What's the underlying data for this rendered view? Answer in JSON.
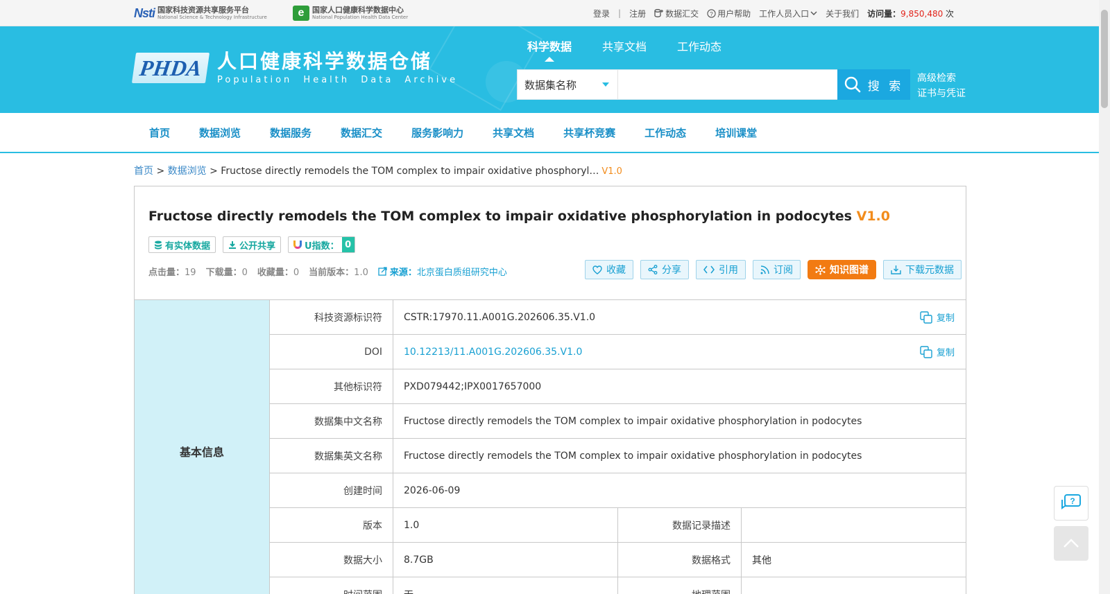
{
  "logos": {
    "nsti_mark": "Nsti",
    "nsti_cn": "国家科技资源共享服务平台",
    "nsti_en": "National Science & Technology Infrastructure",
    "nphdc_mark": "e",
    "nphdc_cn": "国家人口健康科学数据中心",
    "nphdc_en": "National Population Health Data Center",
    "phda_mark": "PHDA",
    "phda_cn": "人口健康科学数据仓储",
    "phda_en": "Population  Health  Data  Archive"
  },
  "toplinks": {
    "login": "登录",
    "separator": "|",
    "register": "注册",
    "data_submit": "数据汇交",
    "help": "用户帮助",
    "staff": "工作人员入口",
    "about": "关于我们",
    "visits_label": "访问量：",
    "visits_value": "9,850,480",
    "visits_unit": " 次"
  },
  "banner_nav": {
    "items": [
      {
        "label": "科学数据",
        "active": true
      },
      {
        "label": "共享文档",
        "active": false
      },
      {
        "label": "工作动态",
        "active": false
      }
    ]
  },
  "search": {
    "scope": "数据集名称",
    "query": "",
    "button": "搜 索",
    "advanced": "高级检索",
    "certificate": "证书与凭证"
  },
  "main_nav": [
    "首页",
    "数据浏览",
    "数据服务",
    "数据汇交",
    "服务影响力",
    "共享文档",
    "共享杯竞赛",
    "工作动态",
    "培训课堂"
  ],
  "breadcrumb": {
    "home": "首页",
    "sep1": " > ",
    "browse": "数据浏览",
    "sep2": " > ",
    "current": "Fructose directly remodels the TOM complex to impair oxidative phosphoryl…",
    "version": "V1.0"
  },
  "dataset": {
    "title": "Fructose directly remodels the TOM complex to impair oxidative phosphorylation in podocytes",
    "version": "V1.0",
    "badges": {
      "entity": "有实体数据",
      "open": "公开共享",
      "uindex_label": "U指数：",
      "uindex_value": "0"
    },
    "stats": {
      "clicks_label": "点击量：",
      "clicks": "19",
      "downloads_label": "下载量：",
      "downloads": "0",
      "favorites_label": "收藏量：",
      "favorites": "0",
      "current_version_label": "当前版本：",
      "current_version": "1.0",
      "source_label": "来源：",
      "source": "北京蛋白质组研究中心"
    },
    "actions": {
      "favorite": "收藏",
      "share": "分享",
      "cite": "引用",
      "subscribe": "订阅",
      "knowledge_graph": "知识图谱",
      "download_meta": "下载元数据"
    }
  },
  "basic_info": {
    "section_title": "基本信息",
    "copy_label": "复制",
    "cstr_label": "科技资源标识符",
    "cstr": "CSTR:17970.11.A001G.202606.35.V1.0",
    "doi_label": "DOI",
    "doi": "10.12213/11.A001G.202606.35.V1.0",
    "other_id_label": "其他标识符",
    "other_id": "PXD079442;IPX0017657000",
    "cn_name_label": "数据集中文名称",
    "cn_name": "Fructose directly remodels the TOM complex to impair oxidative phosphorylation in podocytes",
    "en_name_label": "数据集英文名称",
    "en_name": "Fructose directly remodels the TOM complex to impair oxidative phosphorylation in podocytes",
    "created_label": "创建时间",
    "created": "2026-06-09",
    "version_label": "版本",
    "version": "1.0",
    "record_desc_label": "数据记录描述",
    "record_desc": "",
    "size_label": "数据大小",
    "size": "8.7GB",
    "format_label": "数据格式",
    "format": "其他",
    "time_range_label": "时间范围",
    "time_range": "无",
    "geo_range_label": "地理范围",
    "geo_range": ""
  },
  "colors": {
    "banner": "#29bde2",
    "accent": "#18a0d2",
    "version_orange": "#f28c1c",
    "kg_button": "#f27b12",
    "side_head": "#d1f1f8"
  }
}
